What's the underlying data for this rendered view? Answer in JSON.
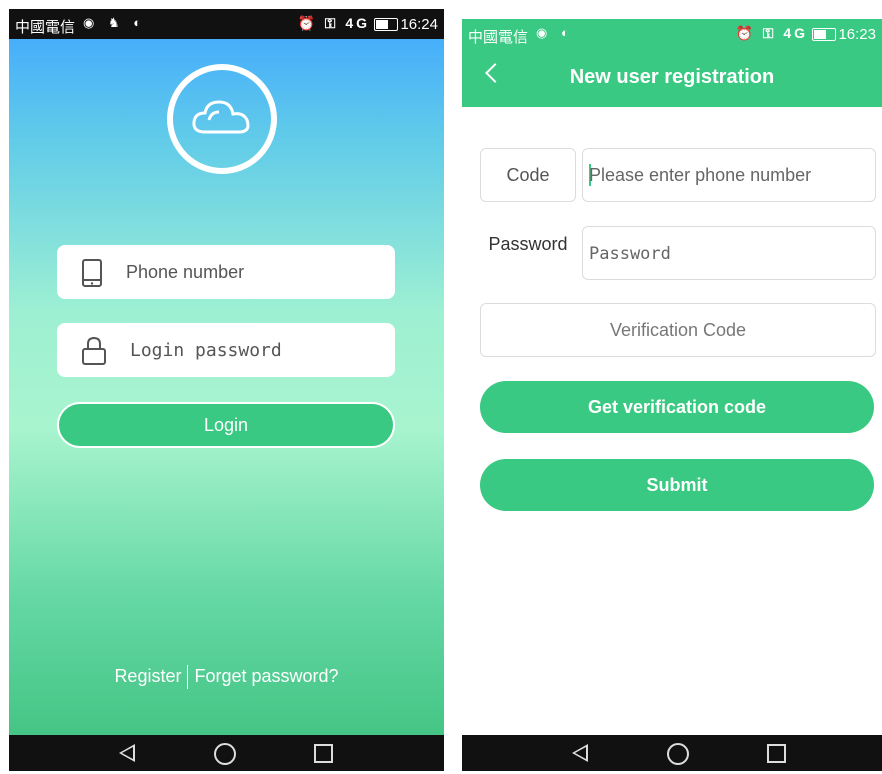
{
  "login_screen": {
    "status_bar": {
      "carrier": "中國電信",
      "network": "4G",
      "time": "16:24"
    },
    "phone_placeholder": "Phone number",
    "password_placeholder": "Login password",
    "login_label": "Login",
    "register_label": "Register",
    "forget_label": "Forget password?"
  },
  "registration_screen": {
    "status_bar": {
      "carrier": "中國電信",
      "network": "4G",
      "time": "16:23"
    },
    "title": "New user registration",
    "code_label": "Code",
    "phone_placeholder": "Please enter phone number",
    "password_label": "Password",
    "password_placeholder": "Password",
    "verification_placeholder": "Verification Code",
    "get_code_label": "Get verification code",
    "submit_label": "Submit"
  },
  "colors": {
    "accent_green": "#3ac982",
    "gradient_top": "#3fa6ff",
    "gradient_mid": "#a8f4cf",
    "gradient_bottom": "#3dc07d"
  },
  "icons": [
    "phone-icon",
    "lock-icon",
    "cloud-icon",
    "back-icon",
    "alarm-icon",
    "key-icon",
    "battery-icon"
  ]
}
